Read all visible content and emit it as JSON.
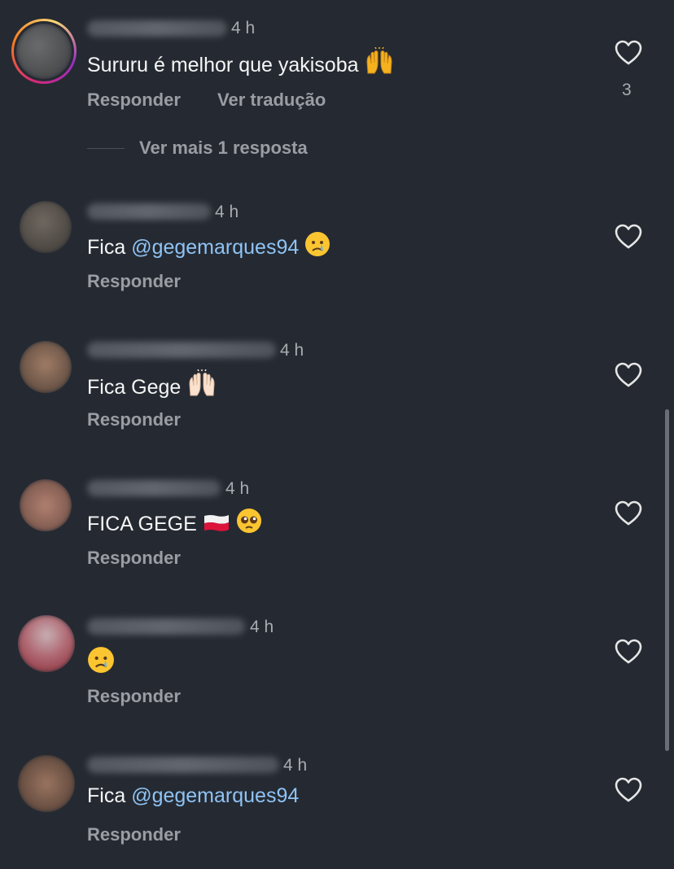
{
  "comments": [
    {
      "time": "4 h",
      "text": "Sururu é melhor que yakisoba",
      "reply": "Responder",
      "translate": "Ver tradução",
      "likes": "3",
      "more_replies": "Ver mais 1 resposta"
    },
    {
      "time": "4 h",
      "text_prefix": "Fica",
      "mention": "@gegemarques94",
      "reply": "Responder"
    },
    {
      "time": "4 h",
      "text": "Fica Gege",
      "reply": "Responder"
    },
    {
      "time": "4 h",
      "text": "FICA GEGE",
      "reply": "Responder"
    },
    {
      "time": "4 h",
      "reply": "Responder"
    },
    {
      "time": "4 h",
      "text_prefix": "Fica",
      "mention": "@gegemarques94",
      "reply": "Responder"
    }
  ],
  "icons": {
    "like": "heart-outline-icon",
    "emoji_1": "raising-hands",
    "emoji_2": "crying-face",
    "flag": "poland-flag",
    "emoji_3": "pleading-face"
  },
  "colors": {
    "background": "#252a32",
    "mention": "#8fc3f5",
    "secondary": "#9a9da3"
  }
}
